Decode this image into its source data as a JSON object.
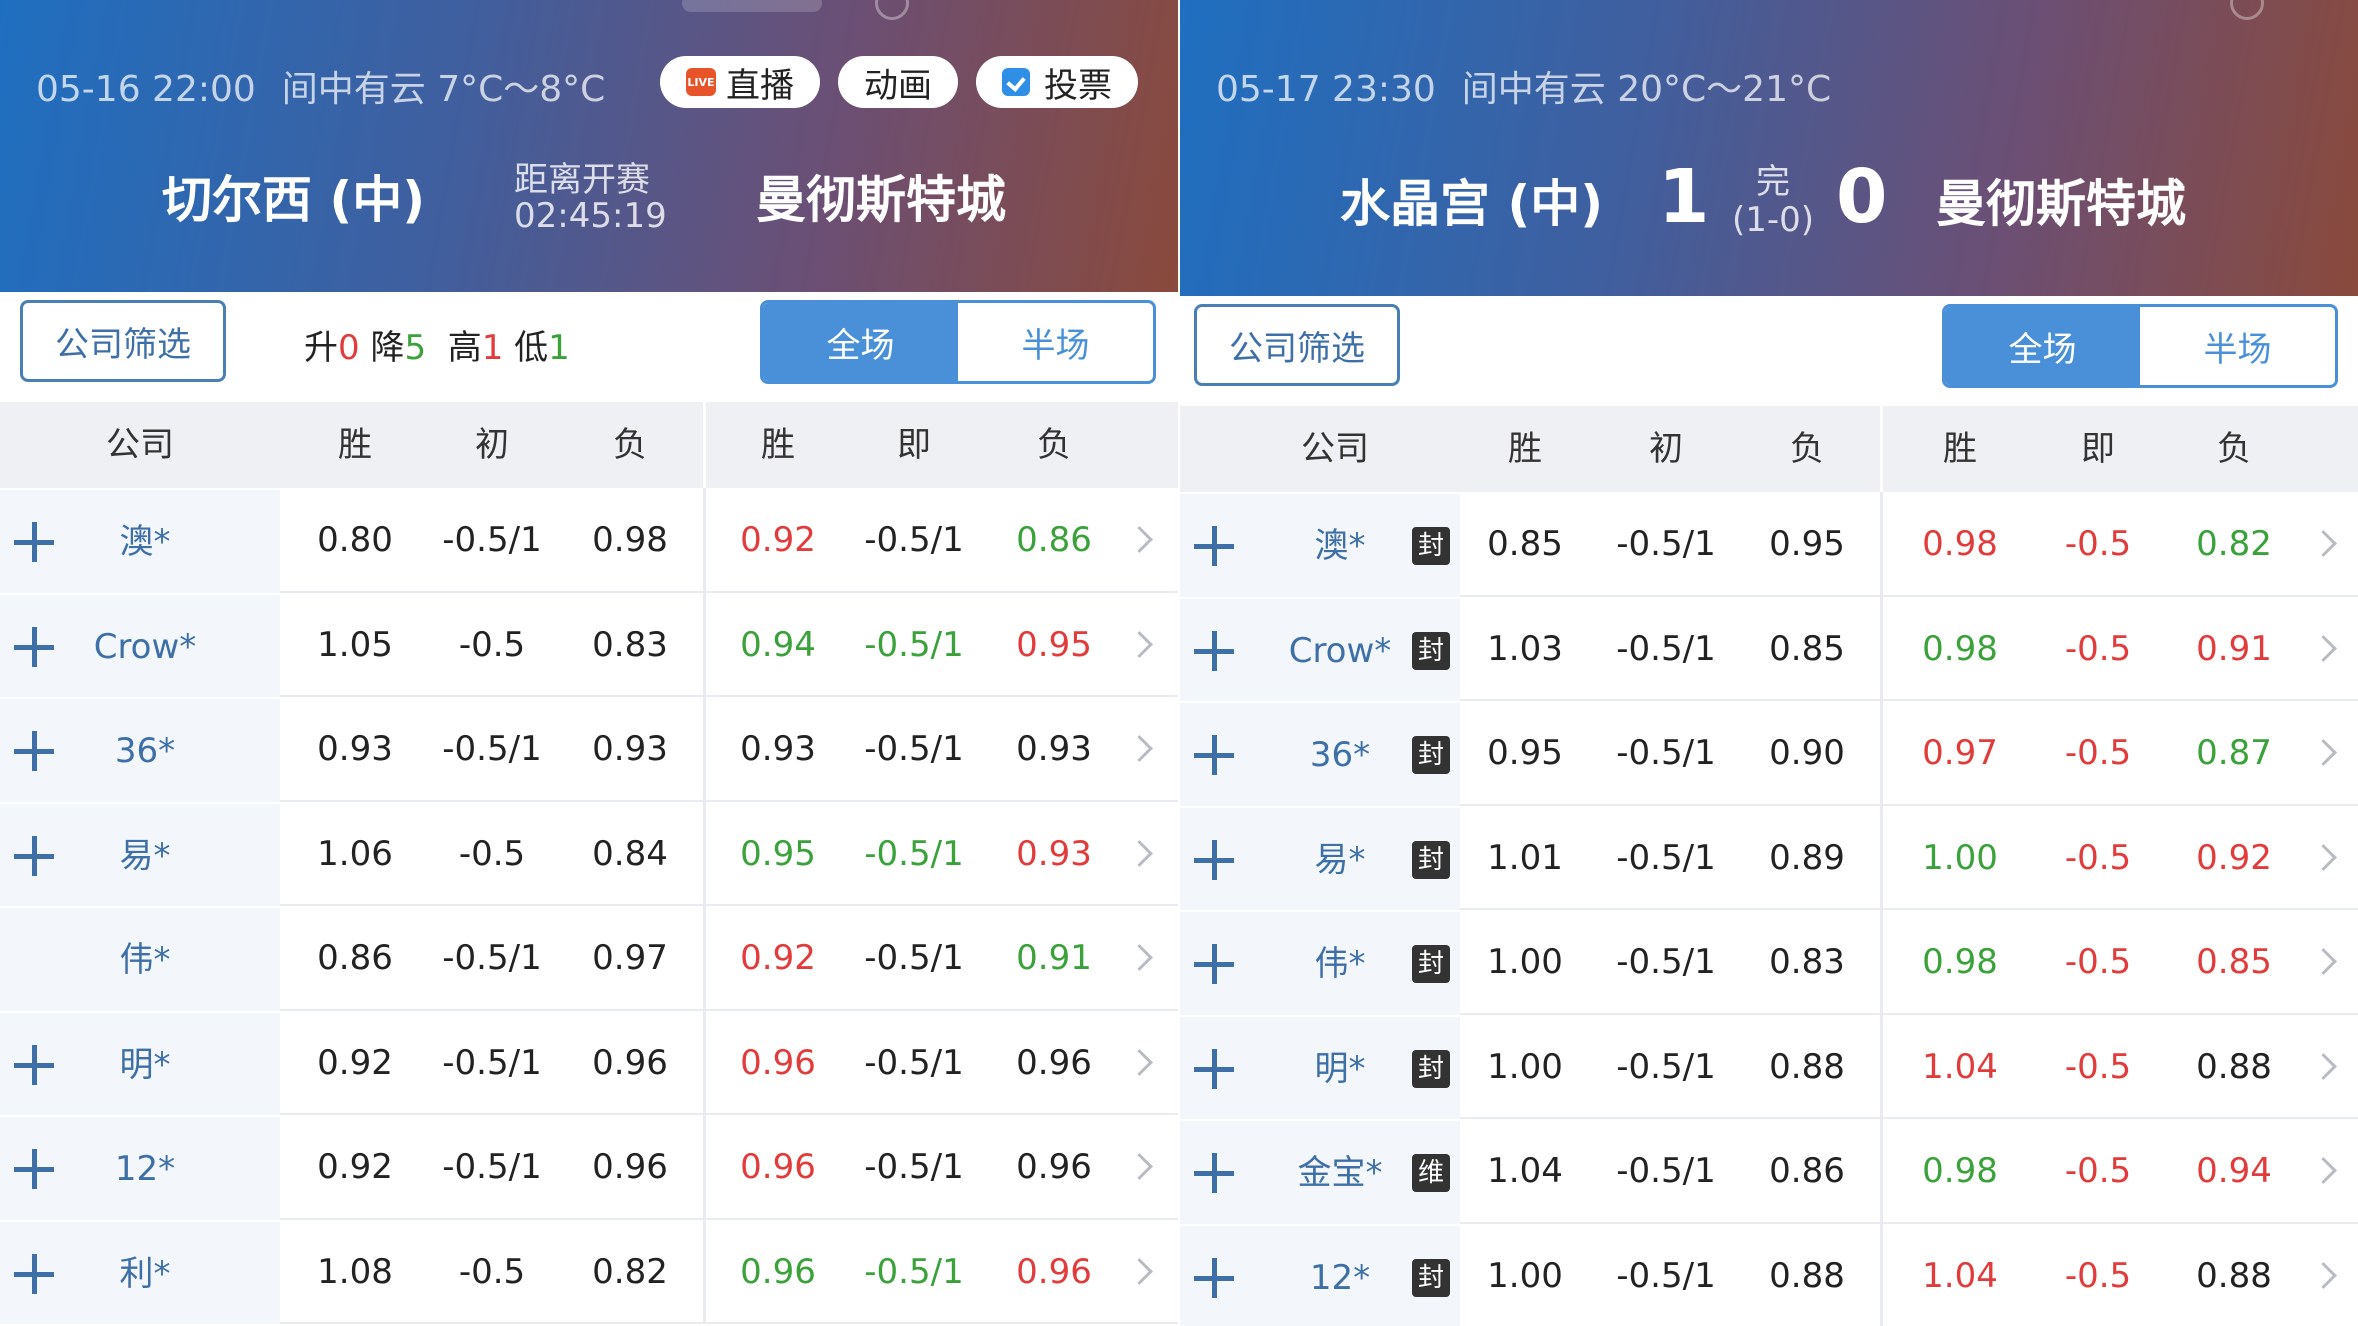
{
  "colors": {
    "up": "#e23b3b",
    "down": "#3ba13b",
    "accent": "#4a90d9",
    "link": "#3e6fa7"
  },
  "left": {
    "meta": {
      "datetime": "05-16 22:00",
      "weather": "间中有云 7°C～8°C"
    },
    "buttons": {
      "live": "直播",
      "live_icon_text": "LIVE",
      "animation": "动画",
      "vote": "投票"
    },
    "home_team": "切尔西 (中)",
    "away_team": "曼彻斯特城",
    "countdown_label": "距离开赛",
    "countdown": "02:45:19",
    "filter_label": "公司筛选",
    "counts": {
      "up_label": "升",
      "up": "0",
      "down_label": "降",
      "down": "5",
      "high_label": "高",
      "high": "1",
      "low_label": "低",
      "low": "1"
    },
    "tabs": {
      "full": "全场",
      "half": "半场"
    },
    "headers": {
      "company": "公司",
      "win1": "胜",
      "initial": "初",
      "lose1": "负",
      "win2": "胜",
      "instant": "即",
      "lose2": "负"
    },
    "rows": [
      {
        "company": "澳*",
        "expand": true,
        "w1": "0.80",
        "h1": "-0.5/1",
        "l1": "0.98",
        "w2": "0.92",
        "h2": "-0.5/1",
        "l2": "0.86",
        "cw2": "up",
        "ch2": "",
        "cl2": "down"
      },
      {
        "company": "Crow*",
        "expand": true,
        "w1": "1.05",
        "h1": "-0.5",
        "l1": "0.83",
        "w2": "0.94",
        "h2": "-0.5/1",
        "l2": "0.95",
        "cw2": "down",
        "ch2": "down",
        "cl2": "up"
      },
      {
        "company": "36*",
        "expand": true,
        "w1": "0.93",
        "h1": "-0.5/1",
        "l1": "0.93",
        "w2": "0.93",
        "h2": "-0.5/1",
        "l2": "0.93",
        "cw2": "",
        "ch2": "",
        "cl2": ""
      },
      {
        "company": "易*",
        "expand": true,
        "w1": "1.06",
        "h1": "-0.5",
        "l1": "0.84",
        "w2": "0.95",
        "h2": "-0.5/1",
        "l2": "0.93",
        "cw2": "down",
        "ch2": "down",
        "cl2": "up"
      },
      {
        "company": "伟*",
        "expand": false,
        "w1": "0.86",
        "h1": "-0.5/1",
        "l1": "0.97",
        "w2": "0.92",
        "h2": "-0.5/1",
        "l2": "0.91",
        "cw2": "up",
        "ch2": "",
        "cl2": "down"
      },
      {
        "company": "明*",
        "expand": true,
        "w1": "0.92",
        "h1": "-0.5/1",
        "l1": "0.96",
        "w2": "0.96",
        "h2": "-0.5/1",
        "l2": "0.96",
        "cw2": "up",
        "ch2": "",
        "cl2": ""
      },
      {
        "company": "12*",
        "expand": true,
        "w1": "0.92",
        "h1": "-0.5/1",
        "l1": "0.96",
        "w2": "0.96",
        "h2": "-0.5/1",
        "l2": "0.96",
        "cw2": "up",
        "ch2": "",
        "cl2": ""
      },
      {
        "company": "利*",
        "expand": true,
        "w1": "1.08",
        "h1": "-0.5",
        "l1": "0.82",
        "w2": "0.96",
        "h2": "-0.5/1",
        "l2": "0.96",
        "cw2": "down",
        "ch2": "down",
        "cl2": "up"
      }
    ]
  },
  "right": {
    "meta": {
      "datetime": "05-17 23:30",
      "weather": "间中有云 20°C～21°C"
    },
    "home_team": "水晶宫 (中)",
    "away_team": "曼彻斯特城",
    "home_score": "1",
    "away_score": "0",
    "status": "完",
    "half_score": "(1-0)",
    "filter_label": "公司筛选",
    "tabs": {
      "full": "全场",
      "half": "半场"
    },
    "headers": {
      "company": "公司",
      "win1": "胜",
      "initial": "初",
      "lose1": "负",
      "win2": "胜",
      "instant": "即",
      "lose2": "负"
    },
    "rows": [
      {
        "company": "澳*",
        "tag": "封",
        "w1": "0.85",
        "h1": "-0.5/1",
        "l1": "0.95",
        "w2": "0.98",
        "h2": "-0.5",
        "l2": "0.82",
        "cw2": "up",
        "ch2": "up",
        "cl2": "down"
      },
      {
        "company": "Crow*",
        "tag": "封",
        "w1": "1.03",
        "h1": "-0.5/1",
        "l1": "0.85",
        "w2": "0.98",
        "h2": "-0.5",
        "l2": "0.91",
        "cw2": "down",
        "ch2": "up",
        "cl2": "up"
      },
      {
        "company": "36*",
        "tag": "封",
        "w1": "0.95",
        "h1": "-0.5/1",
        "l1": "0.90",
        "w2": "0.97",
        "h2": "-0.5",
        "l2": "0.87",
        "cw2": "up",
        "ch2": "up",
        "cl2": "down"
      },
      {
        "company": "易*",
        "tag": "封",
        "w1": "1.01",
        "h1": "-0.5/1",
        "l1": "0.89",
        "w2": "1.00",
        "h2": "-0.5",
        "l2": "0.92",
        "cw2": "down",
        "ch2": "up",
        "cl2": "up"
      },
      {
        "company": "伟*",
        "tag": "封",
        "w1": "1.00",
        "h1": "-0.5/1",
        "l1": "0.83",
        "w2": "0.98",
        "h2": "-0.5",
        "l2": "0.85",
        "cw2": "down",
        "ch2": "up",
        "cl2": "up"
      },
      {
        "company": "明*",
        "tag": "封",
        "w1": "1.00",
        "h1": "-0.5/1",
        "l1": "0.88",
        "w2": "1.04",
        "h2": "-0.5",
        "l2": "0.88",
        "cw2": "up",
        "ch2": "up",
        "cl2": ""
      },
      {
        "company": "金宝*",
        "tag": "维",
        "w1": "1.04",
        "h1": "-0.5/1",
        "l1": "0.86",
        "w2": "0.98",
        "h2": "-0.5",
        "l2": "0.94",
        "cw2": "down",
        "ch2": "up",
        "cl2": "up"
      },
      {
        "company": "12*",
        "tag": "封",
        "w1": "1.00",
        "h1": "-0.5/1",
        "l1": "0.88",
        "w2": "1.04",
        "h2": "-0.5",
        "l2": "0.88",
        "cw2": "up",
        "ch2": "up",
        "cl2": ""
      }
    ]
  }
}
